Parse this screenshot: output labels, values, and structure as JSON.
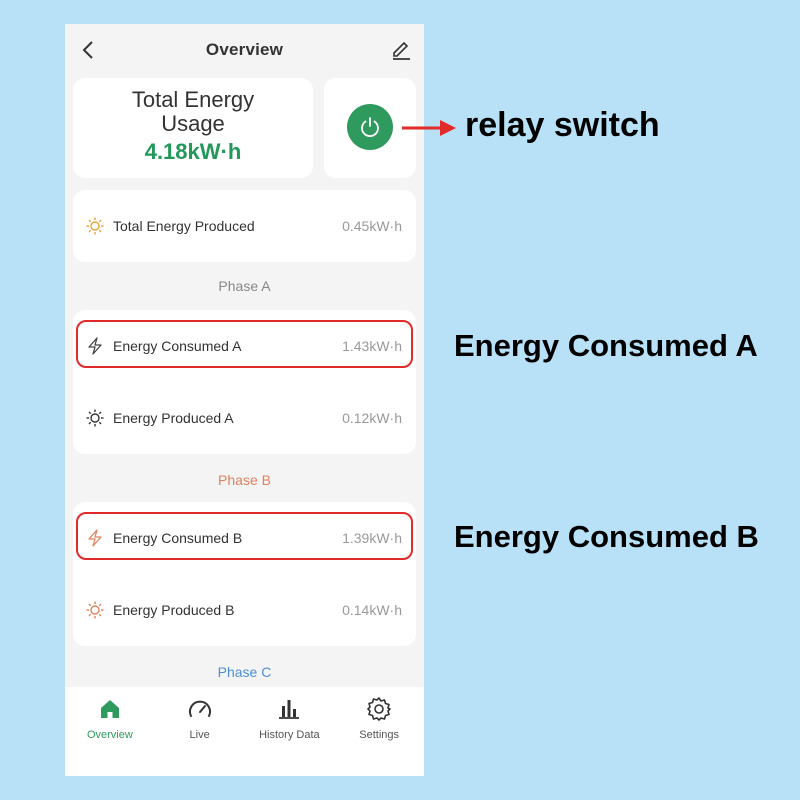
{
  "header": {
    "title": "Overview"
  },
  "summary": {
    "total_label_line1": "Total Energy",
    "total_label_line2": "Usage",
    "total_value": "4.18kW·h"
  },
  "produced_total": {
    "label": "Total Energy Produced",
    "value": "0.45kW·h"
  },
  "phases": [
    {
      "title": "Phase A",
      "title_color": "#888888",
      "consumed": {
        "label": "Energy Consumed A",
        "value": "1.43kW·h"
      },
      "produced": {
        "label": "Energy Produced A",
        "value": "0.12kW·h"
      }
    },
    {
      "title": "Phase B",
      "title_color": "#e0825e",
      "consumed": {
        "label": "Energy Consumed B",
        "value": "1.39kW·h"
      },
      "produced": {
        "label": "Energy Produced B",
        "value": "0.14kW·h"
      }
    },
    {
      "title": "Phase C",
      "title_color": "#4a8fd6"
    }
  ],
  "tabs": [
    {
      "label": "Overview",
      "icon": "home-icon",
      "active": true
    },
    {
      "label": "Live",
      "icon": "gauge-icon"
    },
    {
      "label": "History Data",
      "icon": "bar-chart-icon"
    },
    {
      "label": "Settings",
      "icon": "gear-icon"
    }
  ],
  "annotations": {
    "relay": "relay switch",
    "consumed_a": "Energy Consumed A",
    "consumed_b": "Energy Consumed B"
  },
  "colors": {
    "accent": "#2f9a5e",
    "highlight": "#e22a2a",
    "background": "#b8e0f7",
    "sun_orange": "#e8a33c",
    "phase_b": "#e0825e"
  }
}
